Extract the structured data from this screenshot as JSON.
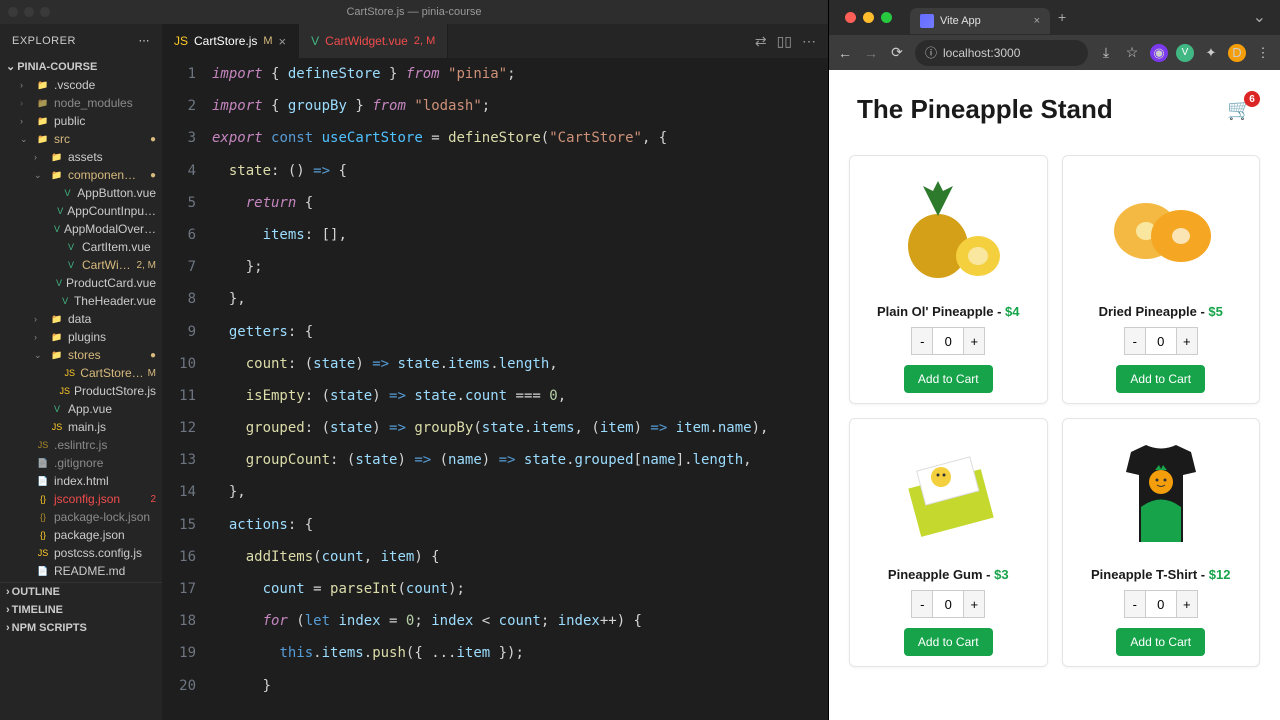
{
  "vscode": {
    "title": "CartStore.js — pinia-course",
    "explorer": "EXPLORER",
    "project": "PINIA-COURSE",
    "sections": {
      "outline": "OUTLINE",
      "timeline": "TIMELINE",
      "npm": "NPM SCRIPTS"
    },
    "tree": [
      {
        "label": ".vscode",
        "type": "folder",
        "indent": 1,
        "chev": "›"
      },
      {
        "label": "node_modules",
        "type": "folder",
        "indent": 1,
        "chev": "›",
        "dim": true
      },
      {
        "label": "public",
        "type": "folder",
        "indent": 1,
        "chev": "›"
      },
      {
        "label": "src",
        "type": "folder",
        "indent": 1,
        "chev": "⌄",
        "modified": true,
        "dot": "●"
      },
      {
        "label": "assets",
        "type": "folder",
        "indent": 2,
        "chev": "›"
      },
      {
        "label": "componen…",
        "type": "folder",
        "indent": 2,
        "chev": "⌄",
        "modified": true,
        "dot": "●"
      },
      {
        "label": "AppButton.vue",
        "type": "vue",
        "indent": 3
      },
      {
        "label": "AppCountInpu…",
        "type": "vue",
        "indent": 3
      },
      {
        "label": "AppModalOver…",
        "type": "vue",
        "indent": 3
      },
      {
        "label": "CartItem.vue",
        "type": "vue",
        "indent": 3
      },
      {
        "label": "CartWi…",
        "type": "vue",
        "indent": 3,
        "modified": true,
        "badge": "2, M"
      },
      {
        "label": "ProductCard.vue",
        "type": "vue",
        "indent": 3
      },
      {
        "label": "TheHeader.vue",
        "type": "vue",
        "indent": 3
      },
      {
        "label": "data",
        "type": "folder",
        "indent": 2,
        "chev": "›"
      },
      {
        "label": "plugins",
        "type": "folder",
        "indent": 2,
        "chev": "›"
      },
      {
        "label": "stores",
        "type": "folder",
        "indent": 2,
        "chev": "⌄",
        "modified": true,
        "dot": "●"
      },
      {
        "label": "CartStore…",
        "type": "js",
        "indent": 3,
        "modified": true,
        "badge": "M"
      },
      {
        "label": "ProductStore.js",
        "type": "js",
        "indent": 3
      },
      {
        "label": "App.vue",
        "type": "vue",
        "indent": 2
      },
      {
        "label": "main.js",
        "type": "js",
        "indent": 2
      },
      {
        "label": ".eslintrc.js",
        "type": "js",
        "indent": 1,
        "dim": true
      },
      {
        "label": ".gitignore",
        "type": "file",
        "indent": 1,
        "dim": true
      },
      {
        "label": "index.html",
        "type": "file",
        "indent": 1
      },
      {
        "label": "jsconfig.json",
        "type": "json",
        "indent": 1,
        "error": true,
        "badge": "2"
      },
      {
        "label": "package-lock.json",
        "type": "json",
        "indent": 1,
        "dim": true
      },
      {
        "label": "package.json",
        "type": "json",
        "indent": 1
      },
      {
        "label": "postcss.config.js",
        "type": "js",
        "indent": 1
      },
      {
        "label": "README.md",
        "type": "file",
        "indent": 1
      }
    ],
    "tabs": [
      {
        "label": "CartStore.js",
        "badge": "M",
        "active": true
      },
      {
        "label": "CartWidget.vue",
        "badge": "2, M",
        "modified": true
      }
    ],
    "lines": [
      "1",
      "2",
      "3",
      "4",
      "5",
      "6",
      "7",
      "8",
      "9",
      "10",
      "11",
      "12",
      "13",
      "14",
      "15",
      "16",
      "17",
      "18",
      "19",
      "20"
    ]
  },
  "browser": {
    "tab_title": "Vite App",
    "url": "localhost:3000",
    "page_title": "The Pineapple Stand",
    "cart_count": "6",
    "add_label": "Add to Cart",
    "products": [
      {
        "name": "Plain Ol' Pineapple - ",
        "price": "$4",
        "qty": "0"
      },
      {
        "name": "Dried Pineapple - ",
        "price": "$5",
        "qty": "0"
      },
      {
        "name": "Pineapple Gum - ",
        "price": "$3",
        "qty": "0"
      },
      {
        "name": "Pineapple T-Shirt - ",
        "price": "$12",
        "qty": "0"
      }
    ]
  }
}
